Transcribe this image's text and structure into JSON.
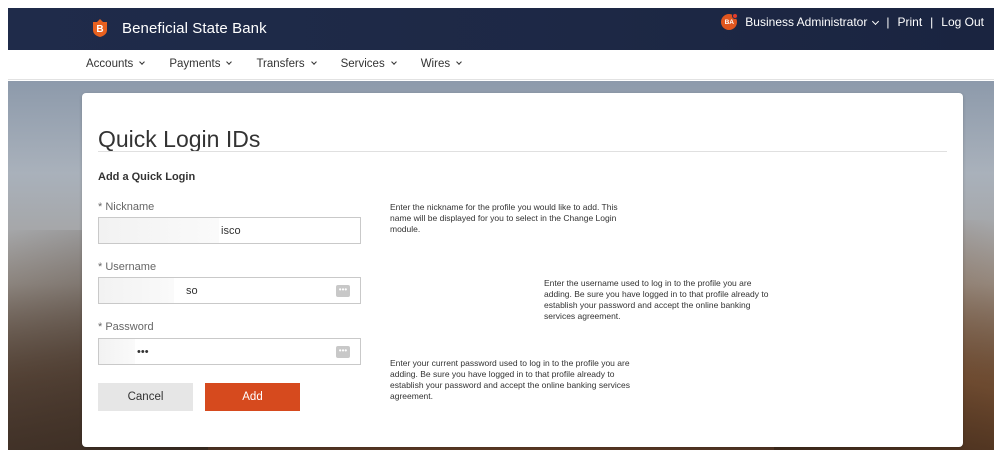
{
  "header": {
    "brand": "Beneficial State Bank",
    "logo_letter": "B",
    "user_initials": "BA",
    "user_menu": "Business Administrator",
    "separator": "|",
    "print": "Print",
    "logout": "Log Out"
  },
  "nav": {
    "items": [
      {
        "label": "Accounts"
      },
      {
        "label": "Payments"
      },
      {
        "label": "Transfers"
      },
      {
        "label": "Services"
      },
      {
        "label": "Wires"
      }
    ]
  },
  "page": {
    "title": "Quick Login IDs",
    "section_title": "Add a Quick Login"
  },
  "form": {
    "nickname": {
      "label": "* Nickname",
      "value": "isco",
      "help": "Enter the nickname for the profile you would like to add. This name will be displayed for you to select in the Change Login module."
    },
    "username": {
      "label": "* Username",
      "value": "so",
      "help": "Enter the username used to log in to the profile you are adding. Be sure you have logged in to that profile already to establish your password and accept the online banking services agreement."
    },
    "password": {
      "label": "* Password",
      "value": "•••",
      "help": "Enter your current password used to log in to the profile you are adding. Be sure you have logged in to that profile already to establish your password and accept the online banking services agreement."
    },
    "key_icon_text": "•••",
    "cancel_label": "Cancel",
    "add_label": "Add"
  },
  "colors": {
    "header_bg": "#1f2b4a",
    "accent": "#d64a1e",
    "badge": "#e0561f"
  }
}
